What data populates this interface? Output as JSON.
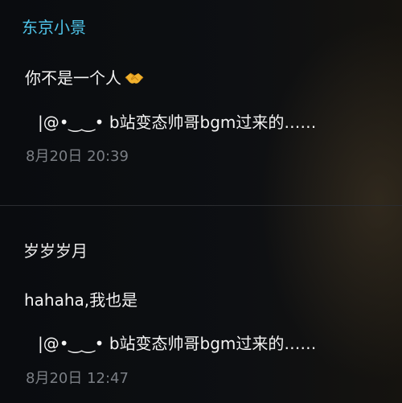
{
  "comments": [
    {
      "username": "东京小景",
      "text": "你不是一个人",
      "emoji": "handshake-emoji",
      "reply_ref": "|@•‿‿•  b站变态帅哥bgm过来的……",
      "timestamp": "8月20日 20:39"
    },
    {
      "username": "岁岁岁月",
      "text": "hahaha,我也是",
      "reply_ref": "|@•‿‿•  b站变态帅哥bgm过来的……",
      "timestamp": "8月20日 12:47"
    }
  ],
  "colors": {
    "username_highlight": "#4fc3e8",
    "username_default": "#e9e9e9",
    "timestamp": "#7b7f85",
    "background": "#0b0d10"
  }
}
